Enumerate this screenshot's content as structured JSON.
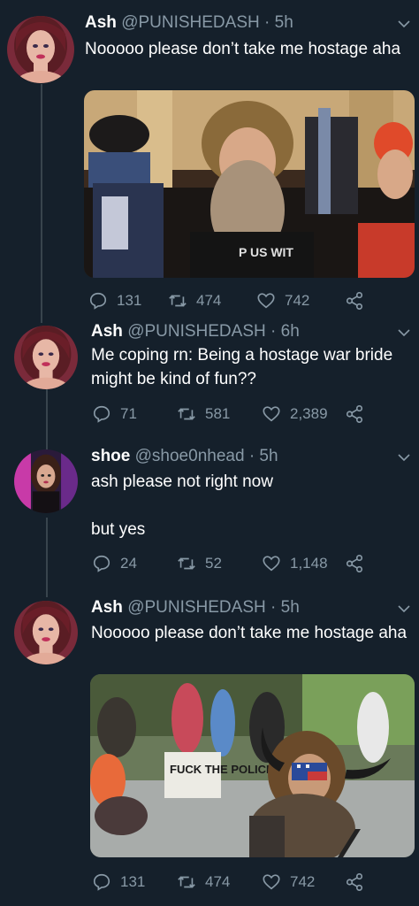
{
  "tweets": [
    {
      "name": "Ash",
      "handle": "@PUNISHEDASH",
      "dot": "·",
      "time": "5h",
      "text": "Nooooo please don’t take me hostage aha",
      "reply_count": "131",
      "retweet_count": "474",
      "like_count": "742"
    },
    {
      "name": "Ash",
      "handle": "@PUNISHEDASH",
      "dot": "·",
      "time": "6h",
      "text": "Me coping rn: Being a hostage war bride might be kind of fun??",
      "reply_count": "71",
      "retweet_count": "581",
      "like_count": "2,389"
    },
    {
      "name": "shoe",
      "handle": "@shoe0nhead",
      "dot": "·",
      "time": "5h",
      "text": "ash please not right now",
      "text2": "but yes",
      "reply_count": "24",
      "retweet_count": "52",
      "like_count": "1,148"
    },
    {
      "name": "Ash",
      "handle": "@PUNISHEDASH",
      "dot": "·",
      "time": "5h",
      "text": "Nooooo please don’t take me hostage aha",
      "media_sign_text": "FUCK THE POLICE",
      "reply_count": "131",
      "retweet_count": "474",
      "like_count": "742"
    }
  ],
  "icons": {
    "reply": "reply-icon",
    "retweet": "retweet-icon",
    "like": "heart-icon",
    "share": "share-icon",
    "chevron": "chevron-down-icon"
  },
  "colors": {
    "background": "#15202b",
    "muted": "#8899a6",
    "thread_line": "#38444d"
  }
}
